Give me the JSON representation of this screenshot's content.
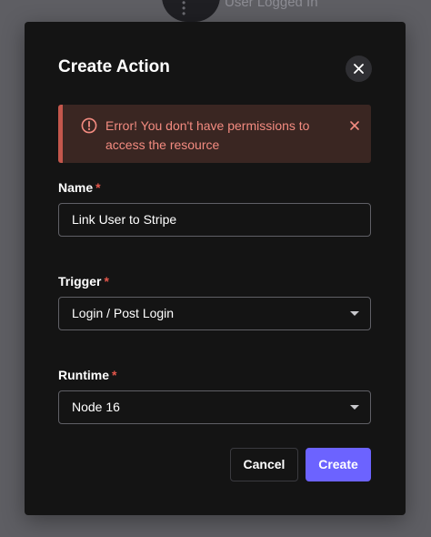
{
  "background": {
    "flow_node_label": "User Logged In"
  },
  "modal": {
    "title": "Create Action",
    "alert": {
      "message": "Error! You don't have permissions to access the resource",
      "color": "#f38b80"
    },
    "fields": {
      "name": {
        "label": "Name",
        "required_mark": "*",
        "value": "Link User to Stripe"
      },
      "trigger": {
        "label": "Trigger",
        "required_mark": "*",
        "value": "Login / Post Login"
      },
      "runtime": {
        "label": "Runtime",
        "required_mark": "*",
        "value": "Node 16"
      }
    },
    "buttons": {
      "cancel": "Cancel",
      "create": "Create"
    }
  },
  "colors": {
    "accent": "#6c63ff",
    "error": "#e3564b",
    "modal_bg": "#141414"
  },
  "icons": {
    "close": "close-icon",
    "alert": "alert-circle-icon",
    "alert_dismiss": "close-icon",
    "dropdown": "caret-down-icon"
  }
}
